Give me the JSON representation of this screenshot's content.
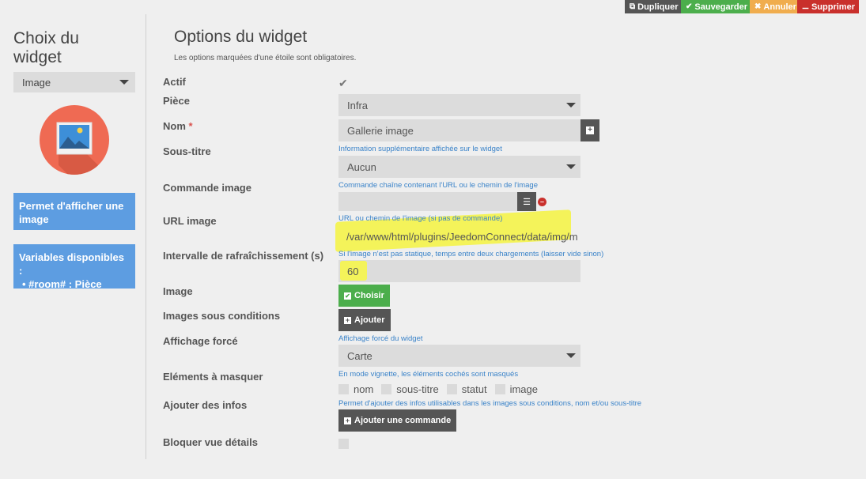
{
  "toolbar": {
    "duplicate_label": "Dupliquer",
    "save_label": "Sauvegarder",
    "cancel_label": "Annuler",
    "delete_label": "Supprimer",
    "colors": {
      "duplicate": "#555555",
      "save": "#4cae4c",
      "cancel": "#f0ad4e",
      "delete": "#c9302c"
    }
  },
  "sidebar": {
    "title": "Choix du widget",
    "widget_select": "Image",
    "description": "Permet d'afficher une image",
    "variables_title": "Variables disponibles :",
    "variables": [
      "#room# : Pièce"
    ]
  },
  "main": {
    "title": "Options du widget",
    "subtitle": "Les options marquées d'une étoile sont obligatoires.",
    "actif": {
      "label": "Actif",
      "checked": true
    },
    "piece": {
      "label": "Pièce",
      "value": "Infra"
    },
    "nom": {
      "label": "Nom",
      "required_mark": "*",
      "value": "Gallerie image"
    },
    "sous_titre": {
      "label": "Sous-titre",
      "help": "Information supplémentaire affichée sur le widget",
      "value": "Aucun"
    },
    "commande_image": {
      "label": "Commande image",
      "help": "Commande chaîne contenant l'URL ou le chemin de l'image",
      "value": ""
    },
    "url_image": {
      "label": "URL image",
      "help": "URL ou chemin de l'image (si pas de commande)",
      "value": "/var/www/html/plugins/JeedomConnect/data/img/m"
    },
    "intervalle": {
      "label": "Intervalle de rafraîchissement (s)",
      "help": "Si l'image n'est pas statique, temps entre deux chargements (laisser vide sinon)",
      "value": "60"
    },
    "image": {
      "label": "Image",
      "button": "Choisir"
    },
    "images_conditions": {
      "label": "Images sous conditions",
      "button": "Ajouter"
    },
    "affichage_force": {
      "label": "Affichage forcé",
      "help": "Affichage forcé du widget",
      "value": "Carte"
    },
    "elements_masquer": {
      "label": "Eléments à masquer",
      "help": "En mode vignette, les éléments cochés sont masqués",
      "options": [
        "nom",
        "sous-titre",
        "statut",
        "image"
      ]
    },
    "ajouter_infos": {
      "label": "Ajouter des infos",
      "help": "Permet d'ajouter des infos utilisables dans les images sous conditions, nom et/ou sous-titre",
      "button": "Ajouter une commande"
    },
    "bloquer": {
      "label": "Bloquer vue détails",
      "checked": false
    }
  }
}
